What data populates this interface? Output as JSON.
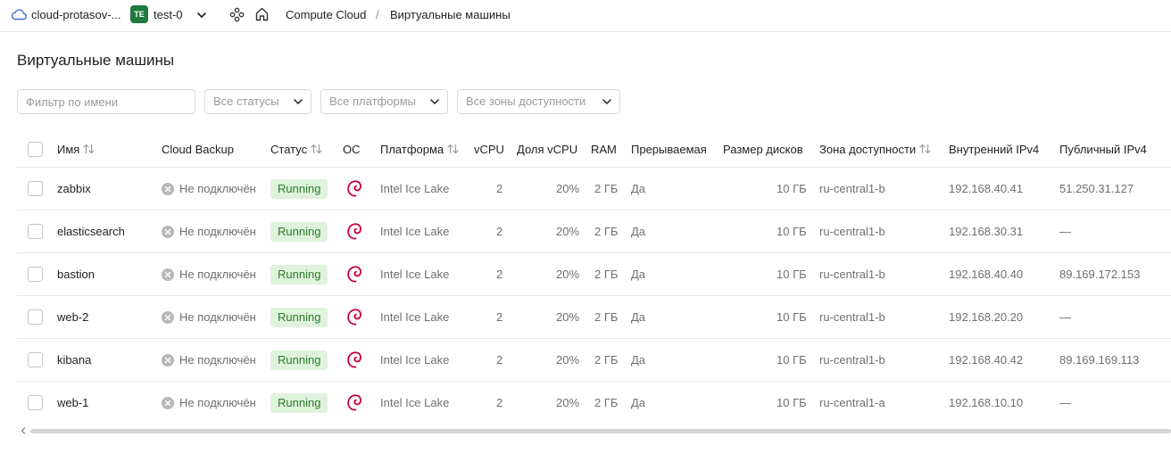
{
  "topbar": {
    "cloud_name": "cloud-protasov-...",
    "folder_badge": "TE",
    "folder_name": "test-0",
    "crumb_service": "Compute Cloud",
    "crumb_separator": "/",
    "crumb_current": "Виртуальные машины"
  },
  "page": {
    "title": "Виртуальные машины"
  },
  "filters": {
    "name_placeholder": "Фильтр по имени",
    "status": "Все статусы",
    "platform": "Все платформы",
    "zone": "Все зоны доступности"
  },
  "table": {
    "columns": {
      "name": "Имя",
      "backup": "Cloud Backup",
      "status": "Статус",
      "os": "ОС",
      "platform": "Платформа",
      "vcpu": "vCPU",
      "vcpu_share": "Доля vCPU",
      "ram": "RAM",
      "preemptible": "Прерываемая",
      "disk": "Размер дисков",
      "zone": "Зона доступности",
      "ipv4_internal": "Внутренний IPv4",
      "ipv4_public": "Публичный IPv4"
    },
    "rows": [
      {
        "name": "zabbix",
        "backup": "Не подключён",
        "status": "Running",
        "os": "debian-icon",
        "platform": "Intel Ice Lake",
        "vcpu": "2",
        "vcpu_share": "20%",
        "ram": "2 ГБ",
        "preemptible": "Да",
        "disk": "10 ГБ",
        "zone": "ru-central1-b",
        "ipv4_internal": "192.168.40.41",
        "ipv4_public": "51.250.31.127"
      },
      {
        "name": "elasticsearch",
        "backup": "Не подключён",
        "status": "Running",
        "os": "debian-icon",
        "platform": "Intel Ice Lake",
        "vcpu": "2",
        "vcpu_share": "20%",
        "ram": "2 ГБ",
        "preemptible": "Да",
        "disk": "10 ГБ",
        "zone": "ru-central1-b",
        "ipv4_internal": "192.168.30.31",
        "ipv4_public": "—"
      },
      {
        "name": "bastion",
        "backup": "Не подключён",
        "status": "Running",
        "os": "debian-icon",
        "platform": "Intel Ice Lake",
        "vcpu": "2",
        "vcpu_share": "20%",
        "ram": "2 ГБ",
        "preemptible": "Да",
        "disk": "10 ГБ",
        "zone": "ru-central1-b",
        "ipv4_internal": "192.168.40.40",
        "ipv4_public": "89.169.172.153"
      },
      {
        "name": "web-2",
        "backup": "Не подключён",
        "status": "Running",
        "os": "debian-icon",
        "platform": "Intel Ice Lake",
        "vcpu": "2",
        "vcpu_share": "20%",
        "ram": "2 ГБ",
        "preemptible": "Да",
        "disk": "10 ГБ",
        "zone": "ru-central1-b",
        "ipv4_internal": "192.168.20.20",
        "ipv4_public": "—"
      },
      {
        "name": "kibana",
        "backup": "Не подключён",
        "status": "Running",
        "os": "debian-icon",
        "platform": "Intel Ice Lake",
        "vcpu": "2",
        "vcpu_share": "20%",
        "ram": "2 ГБ",
        "preemptible": "Да",
        "disk": "10 ГБ",
        "zone": "ru-central1-b",
        "ipv4_internal": "192.168.40.42",
        "ipv4_public": "89.169.169.113"
      },
      {
        "name": "web-1",
        "backup": "Не подключён",
        "status": "Running",
        "os": "debian-icon",
        "platform": "Intel Ice Lake",
        "vcpu": "2",
        "vcpu_share": "20%",
        "ram": "2 ГБ",
        "preemptible": "Да",
        "disk": "10 ГБ",
        "zone": "ru-central1-a",
        "ipv4_internal": "192.168.10.10",
        "ipv4_public": "—"
      }
    ]
  },
  "colors": {
    "status_running_bg": "#dff3dc",
    "status_running_text": "#2c7a2c",
    "folder_badge_bg": "#1e7a3d",
    "debian_red": "#c70036",
    "cloud_icon": "#3a6fd8"
  }
}
